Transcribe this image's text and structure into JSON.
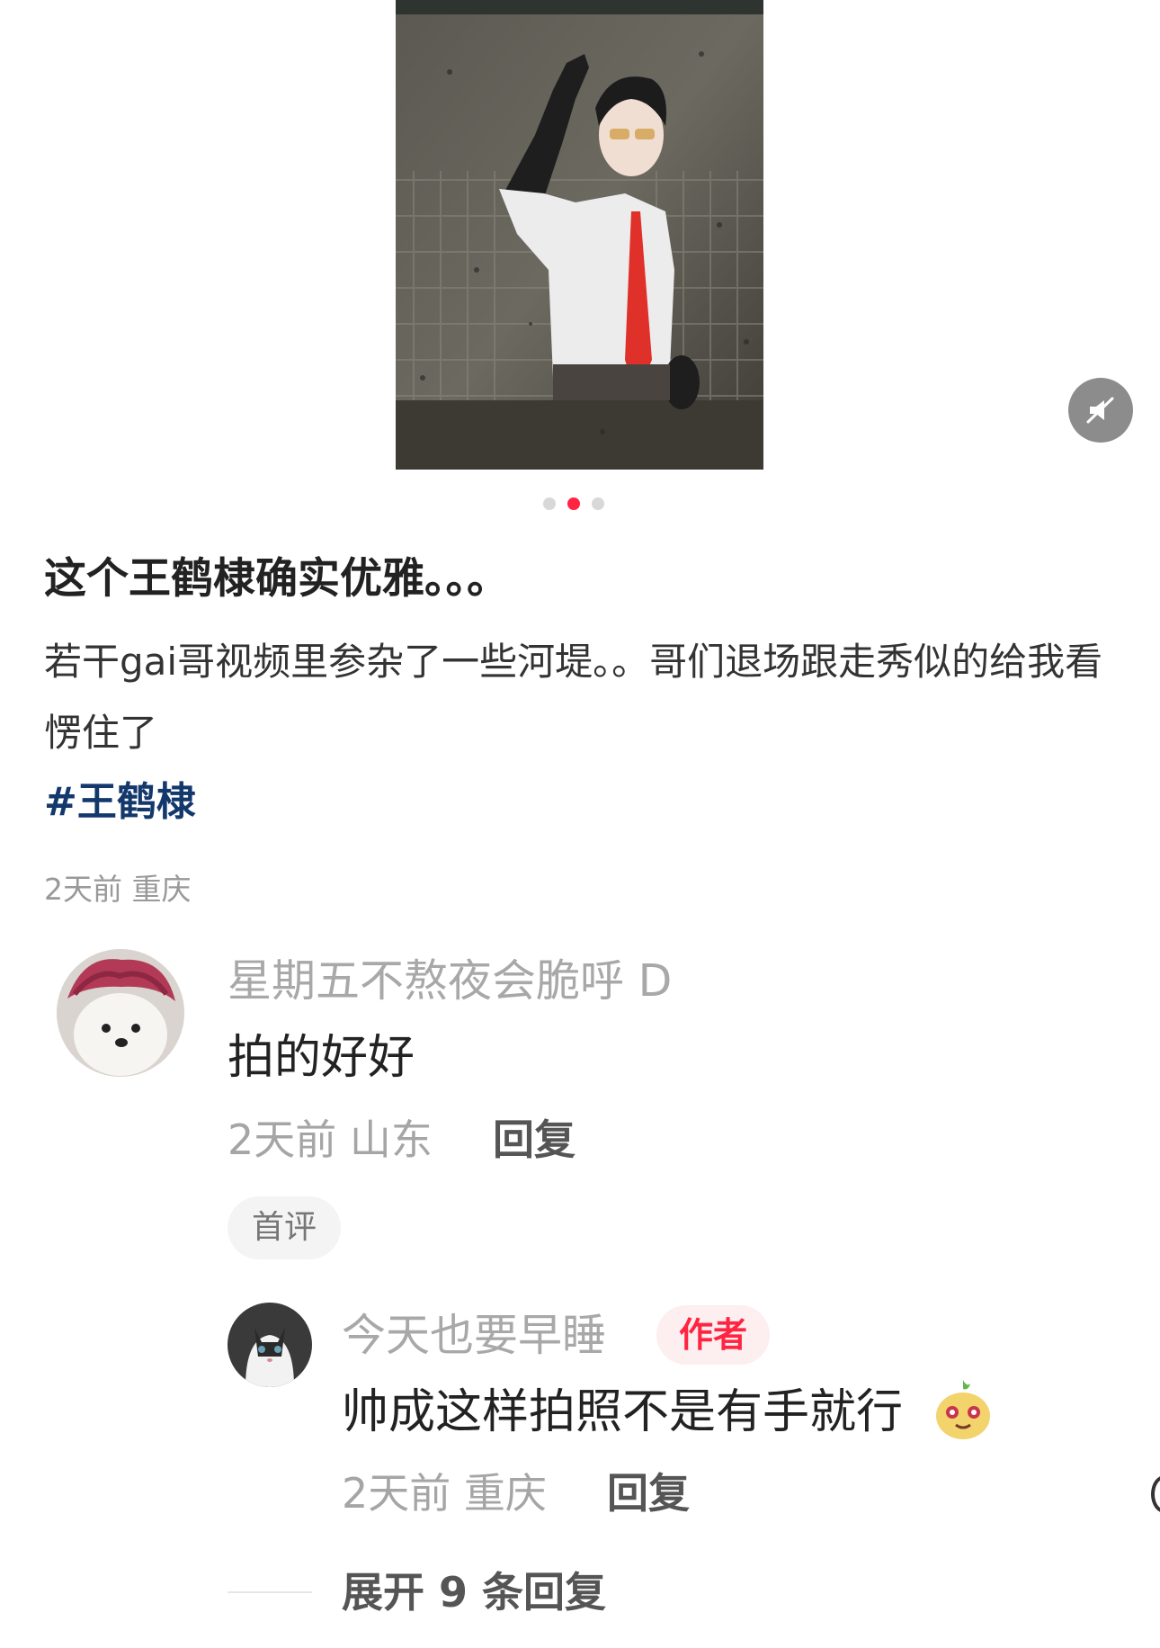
{
  "post": {
    "title": "这个王鹤棣确实优雅。。。",
    "body": "若干gai哥视频里参杂了一些河堤。。哥们退场跟走秀似的给我看愣住了",
    "hashtag": "#王鹤棣",
    "meta": "2天前 重庆"
  },
  "carousel": {
    "total": 3,
    "active_index": 1
  },
  "icons": {
    "mute": "volume-off-icon"
  },
  "colors": {
    "accent": "#ff2442",
    "hashtag": "#13386c",
    "muted_text": "#a8a8a8"
  },
  "comments": [
    {
      "username": "星期五不熬夜会脆呼 D",
      "text": "拍的好好",
      "meta": "2天前 山东",
      "reply_label": "回复",
      "badge": "首评",
      "replies": [
        {
          "username": "今天也要早睡",
          "author_badge": "作者",
          "text": "帅成这样拍照不是有手就行",
          "meta": "2天前 重庆",
          "reply_label": "回复"
        }
      ],
      "expand_label": "展开 9 条回复"
    }
  ]
}
